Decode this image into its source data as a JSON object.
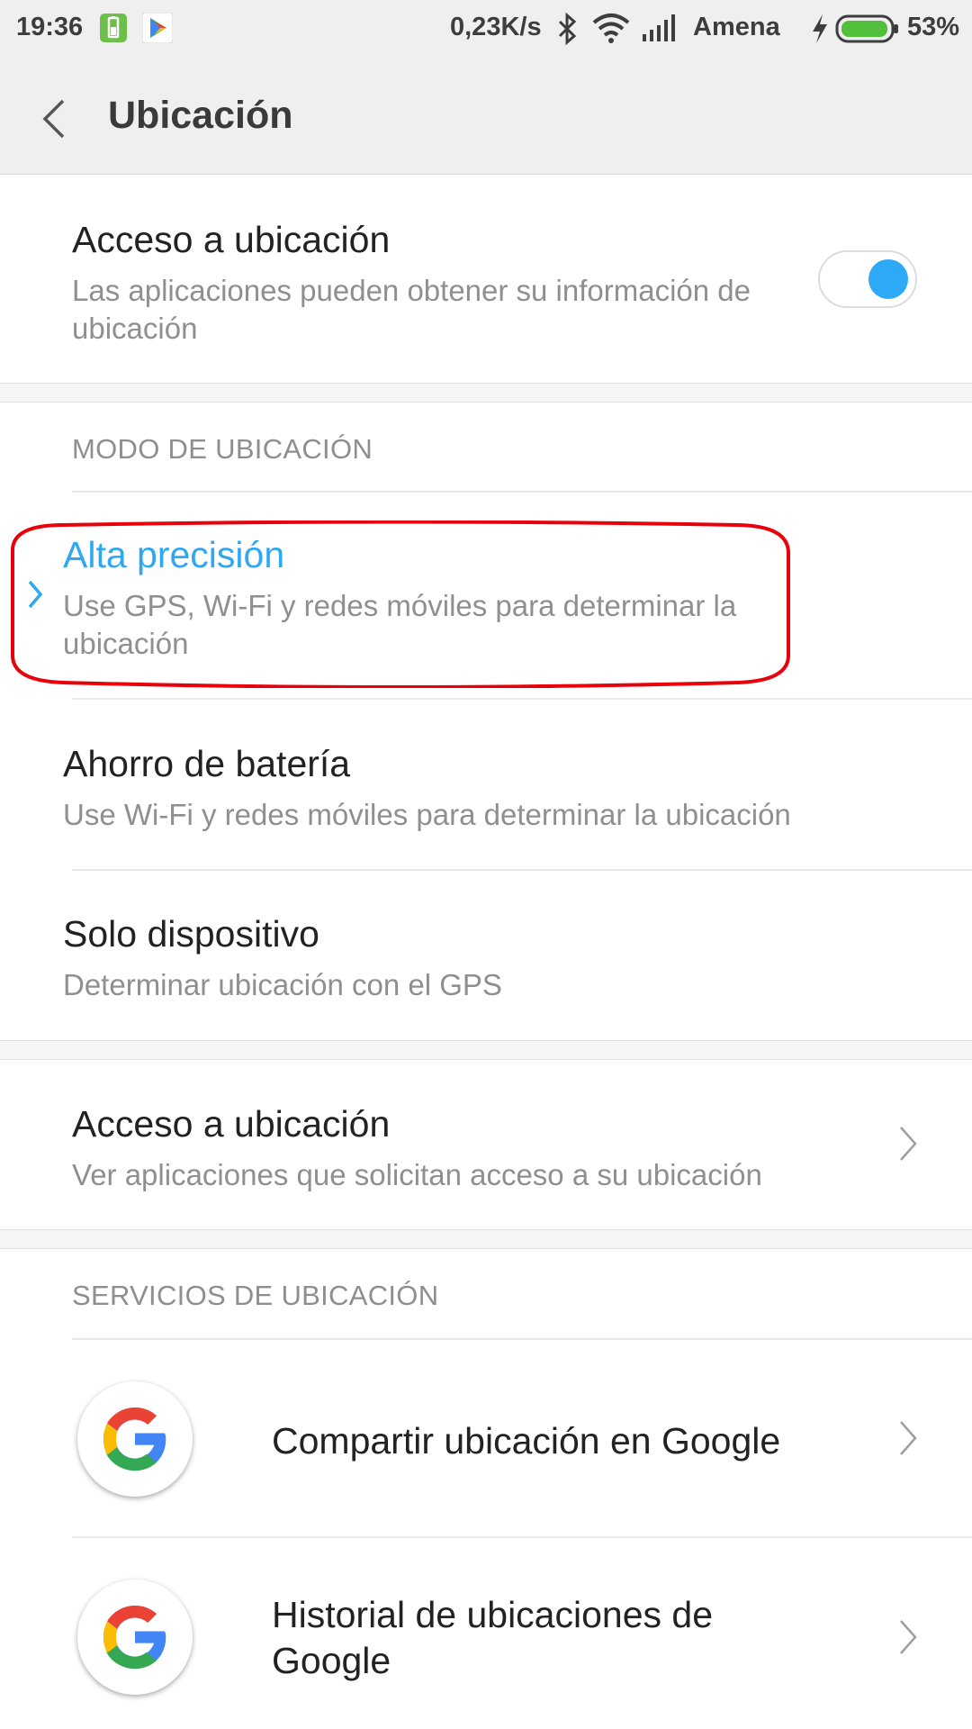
{
  "status_bar": {
    "time": "19:36",
    "speed": "0,23K/s",
    "carrier": "Amena",
    "battery_percent": "53%",
    "battery_level": 0.53,
    "icons": [
      "battery-saver-icon",
      "play-store-icon",
      "bluetooth-icon",
      "wifi-icon",
      "signal-icon",
      "charging-icon",
      "battery-icon"
    ]
  },
  "header": {
    "title": "Ubicación"
  },
  "location_access": {
    "title": "Acceso a ubicación",
    "subtitle": "Las aplicaciones pueden obtener su información de ubicación",
    "enabled": true
  },
  "mode_section": {
    "label": "MODO DE UBICACIÓN",
    "options": [
      {
        "title": "Alta precisión",
        "subtitle": "Use GPS, Wi-Fi y redes móviles para determinar la ubicación",
        "selected": true
      },
      {
        "title": "Ahorro de batería",
        "subtitle": "Use Wi-Fi y redes móviles para determinar la ubicación",
        "selected": false
      },
      {
        "title": "Solo dispositivo",
        "subtitle": "Determinar ubicación con el GPS",
        "selected": false
      }
    ]
  },
  "app_access": {
    "title": "Acceso a ubicación",
    "subtitle": "Ver aplicaciones que solicitan acceso a su ubicación"
  },
  "services_section": {
    "label": "SERVICIOS DE UBICACIÓN",
    "items": [
      {
        "title": "Compartir ubicación en Google",
        "icon": "google-icon"
      },
      {
        "title": "Historial de ubicaciones de Google",
        "icon": "google-icon"
      }
    ]
  },
  "colors": {
    "accent": "#2fa8f2",
    "highlight_ring": "#e8000b",
    "header_bg": "#efefef"
  }
}
